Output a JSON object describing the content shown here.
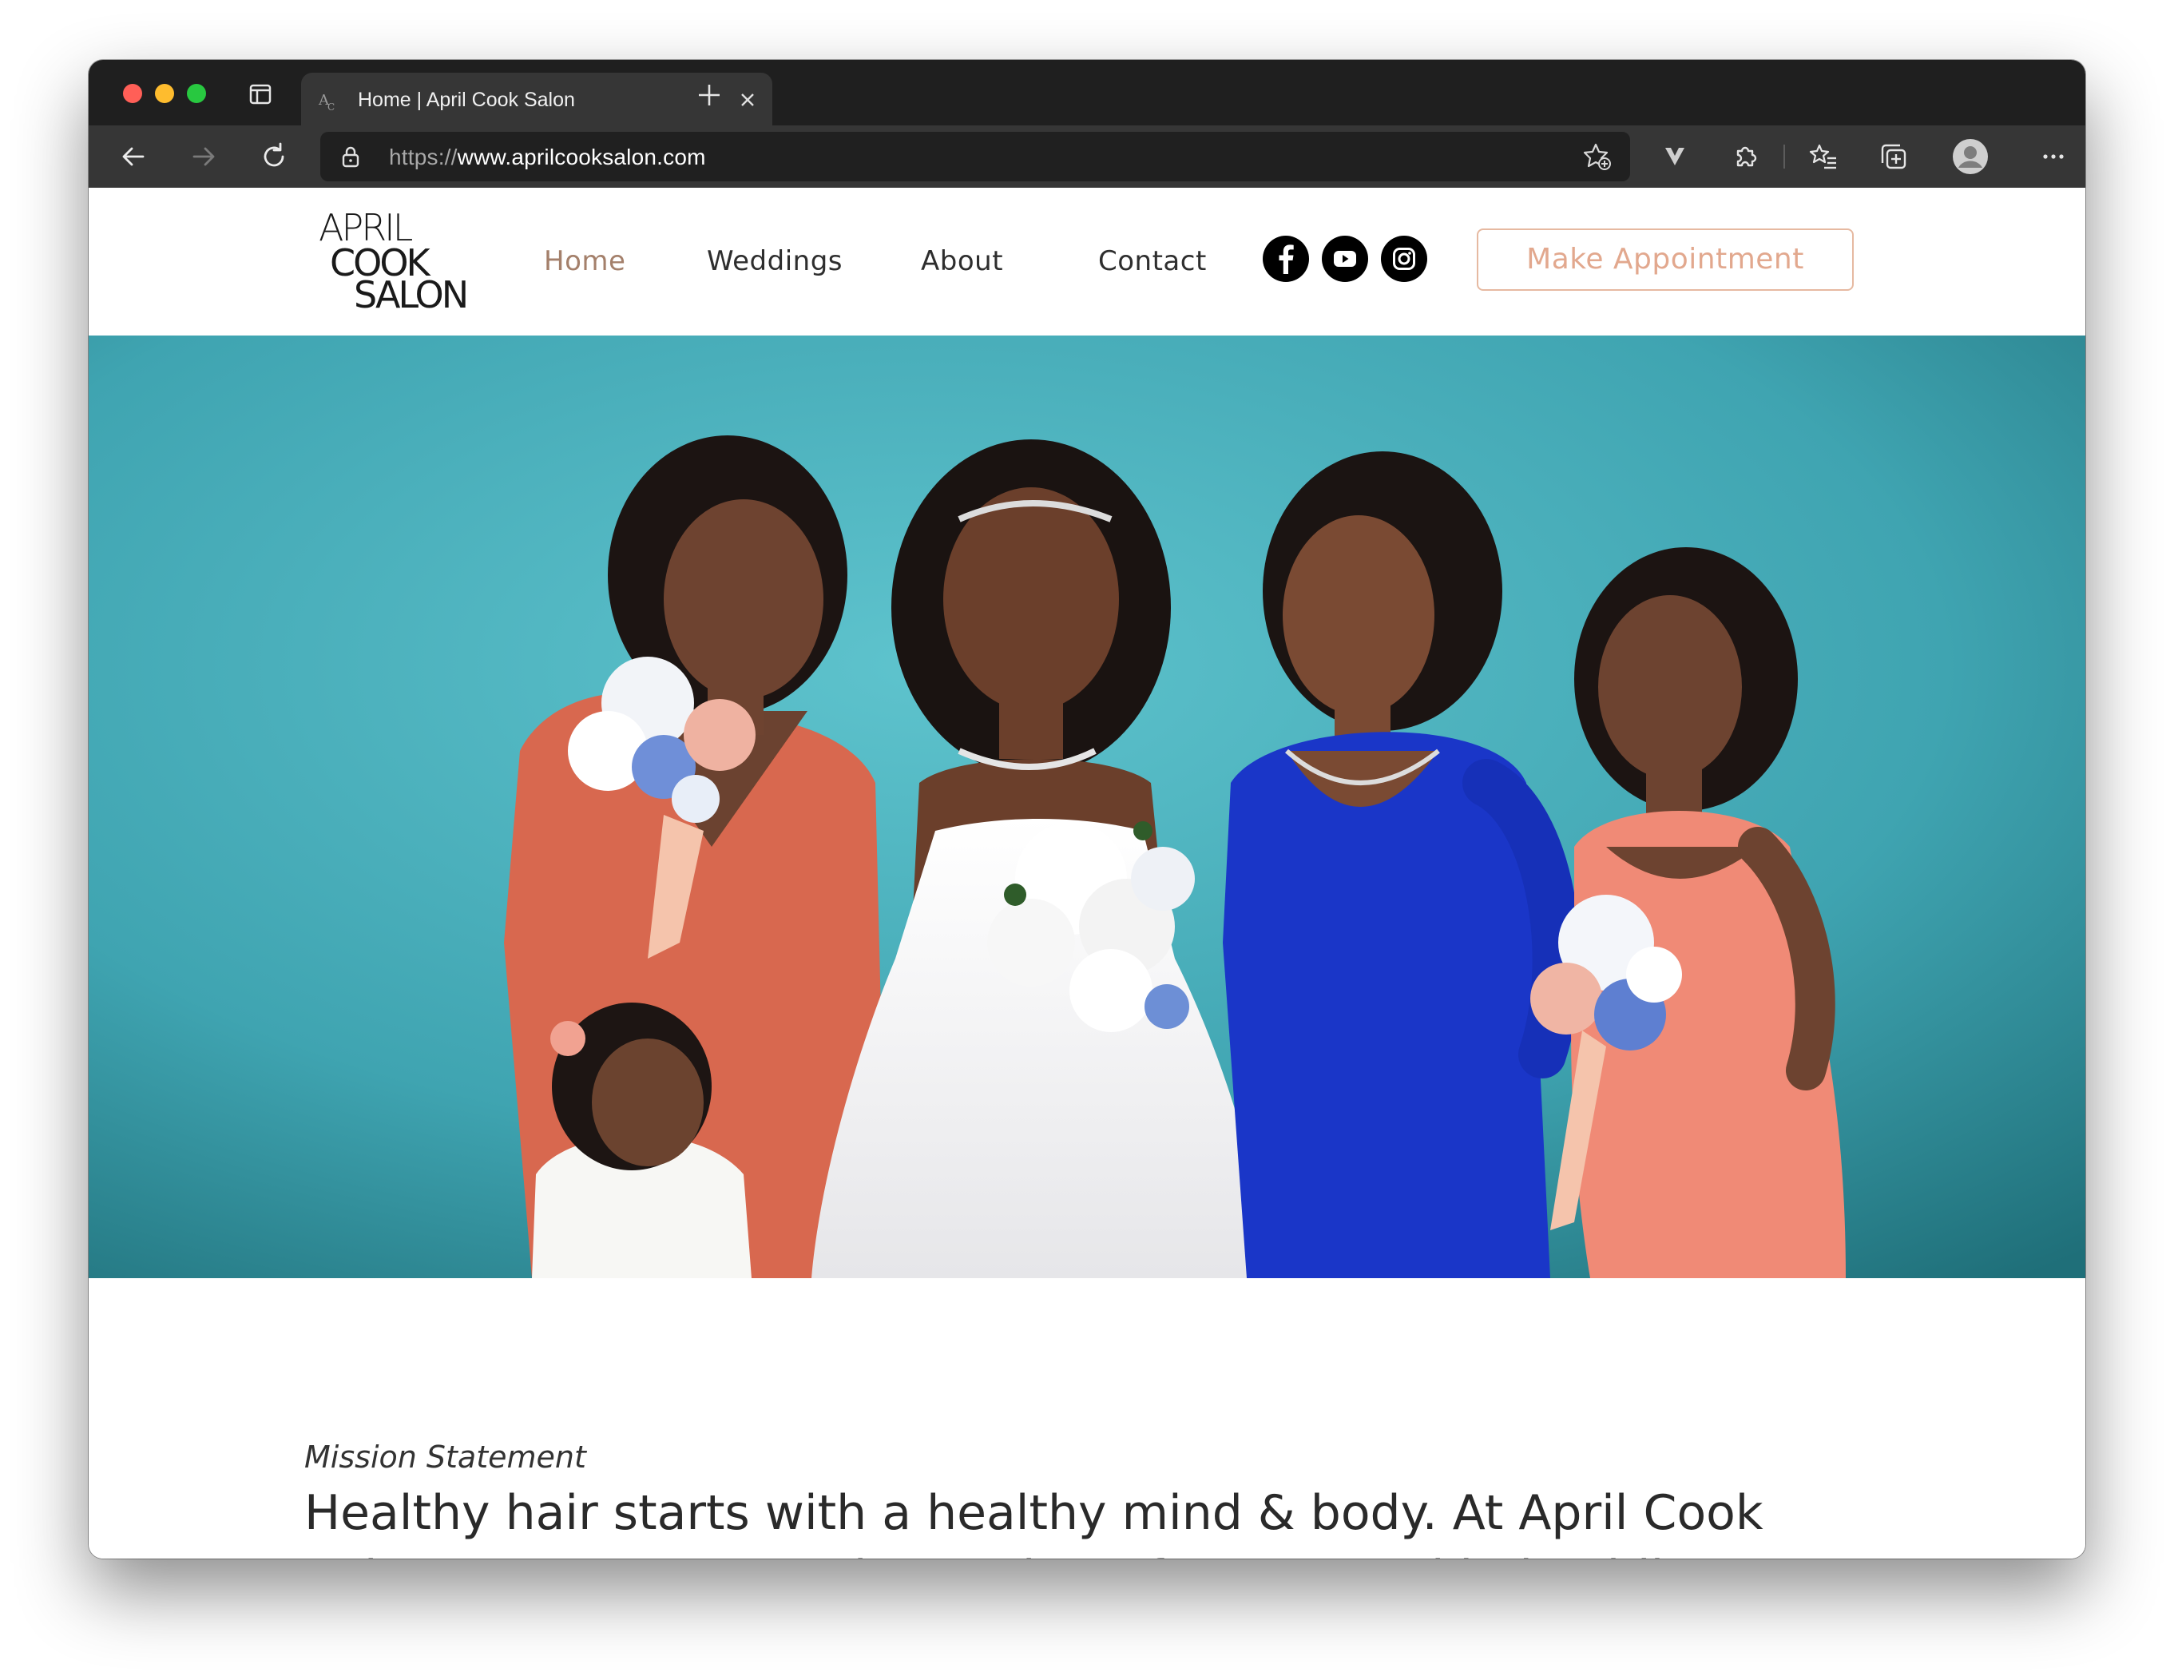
{
  "browser": {
    "tab_title": "Home | April Cook Salon",
    "url_scheme": "https://",
    "url_rest": "www.aprilcooksalon.com"
  },
  "logo": {
    "line1": "APRIL",
    "line2": "COOK",
    "line3": "SALON"
  },
  "nav": {
    "items": [
      {
        "label": "Home",
        "active": true
      },
      {
        "label": "Weddings"
      },
      {
        "label": "About"
      },
      {
        "label": "Contact"
      }
    ]
  },
  "social": {
    "icons": [
      "facebook-icon",
      "youtube-icon",
      "instagram-icon"
    ]
  },
  "cta": {
    "label": "Make Appointment"
  },
  "mission": {
    "label": "Mission Statement",
    "text": "Healthy hair starts with a healthy mind & body. At April Cook Salon LLC we treat each member of our natural hair while providing quality"
  },
  "colors": {
    "accent_active_nav": "#a4806b",
    "cta_border": "#e6b9a1",
    "hero_background": "#3fa4b1"
  }
}
